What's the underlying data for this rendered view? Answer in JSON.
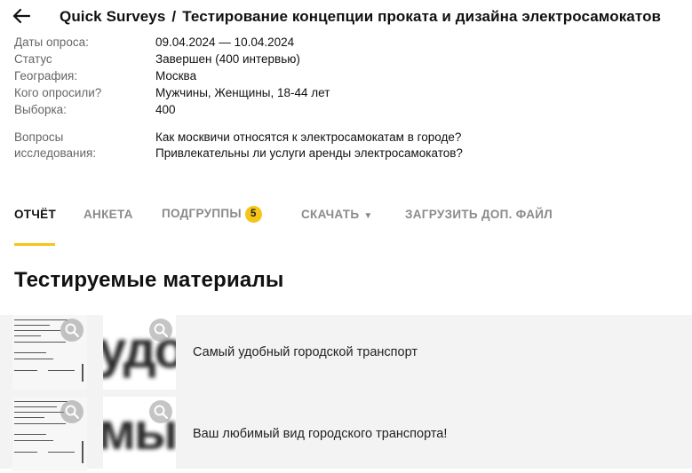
{
  "header": {
    "back_icon": "arrow-left-icon",
    "brand": "Quick Surveys",
    "separator": "/",
    "survey_title": "Тестирование концепции проката и дизайна электросамокатов"
  },
  "meta": [
    {
      "key": "Даты опроса:",
      "value": "09.04.2024 — 10.04.2024"
    },
    {
      "key": "Статус",
      "value": "Завершен (400 интервью)"
    },
    {
      "key": "География:",
      "value": "Москва"
    },
    {
      "key": "Кого опросили?",
      "value": "Мужчины, Женщины, 18-44 лет"
    },
    {
      "key": "Выборка:",
      "value": "400"
    }
  ],
  "questions": {
    "key": "Вопросы исследования:",
    "values": [
      "Как москвичи относятся к электросамокатам в городе?",
      "Привлекательны ли услуги аренды электросамокатов?"
    ]
  },
  "tabs": [
    {
      "label": "ОТЧЁТ",
      "active": true
    },
    {
      "label": "АНКЕТА",
      "active": false
    },
    {
      "label": "ПОДГРУППЫ",
      "badge": "5",
      "active": false
    },
    {
      "label": "СКАЧАТЬ",
      "caret": "▼",
      "active": false
    },
    {
      "label": "ЗАГРУЗИТЬ ДОП. ФАЙЛ",
      "active": false
    }
  ],
  "section": {
    "title": "Тестируемые материалы"
  },
  "materials": [
    {
      "preview_text": "удо",
      "caption": "Самый удобный городской транспорт"
    },
    {
      "preview_text": "мый",
      "caption": "Ваш любимый вид городского транспорта!"
    }
  ],
  "colors": {
    "accent": "#f5c518",
    "panel": "#f3f3f3",
    "muted": "#666666"
  }
}
